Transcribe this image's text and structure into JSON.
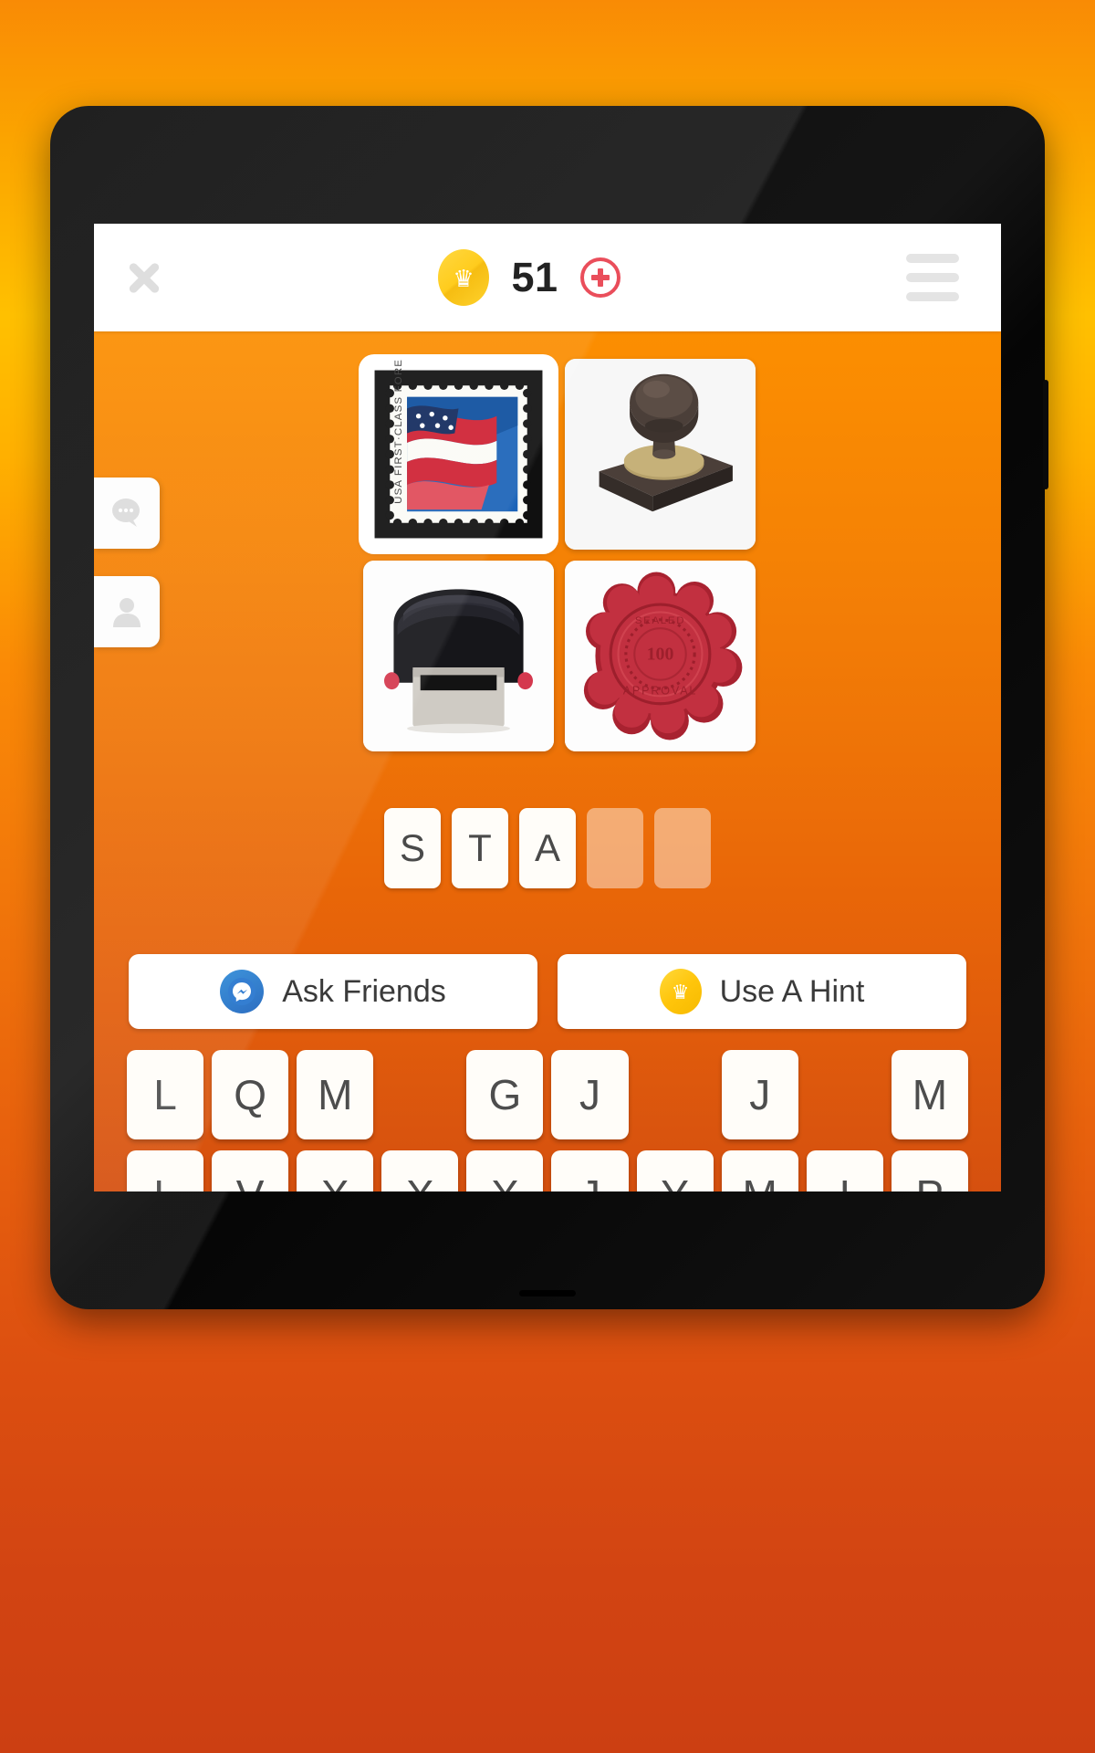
{
  "header": {
    "close_icon": "close-x-icon",
    "crown_icon": "crown-coin-icon",
    "coin_count": "51",
    "add_icon": "plus-circle-icon",
    "menu_icon": "hamburger-menu-icon"
  },
  "side_tabs": [
    {
      "icon": "chat-bubble-icon",
      "name": "chat-tab"
    },
    {
      "icon": "person-icon",
      "name": "profile-tab"
    }
  ],
  "puzzle": {
    "images": [
      {
        "alt": "USA First Class Forever postage stamp with American flag",
        "caption": "USA FIRST-CLASS FOREVER",
        "selected": true
      },
      {
        "alt": "Wooden handle metal rubber stamp with round knob",
        "caption": "",
        "selected": false
      },
      {
        "alt": "Black self-inking rubber stamp",
        "caption": "",
        "selected": false
      },
      {
        "alt": "Red wax seal stamped APPROVAL 100",
        "caption": "APPROVAL",
        "selected": false
      }
    ],
    "answer_slots": [
      {
        "letter": "S",
        "filled": true
      },
      {
        "letter": "T",
        "filled": true
      },
      {
        "letter": "A",
        "filled": true
      },
      {
        "letter": "",
        "filled": false
      },
      {
        "letter": "",
        "filled": false
      }
    ]
  },
  "actions": {
    "ask_friends": {
      "label": "Ask Friends",
      "icon": "messenger-icon"
    },
    "use_hint": {
      "label": "Use A Hint",
      "icon": "crown-coin-icon"
    }
  },
  "keyboard": {
    "rows": [
      [
        {
          "letter": "L",
          "used": false
        },
        {
          "letter": "Q",
          "used": false
        },
        {
          "letter": "M",
          "used": false
        },
        {
          "letter": "",
          "used": true
        },
        {
          "letter": "G",
          "used": false
        },
        {
          "letter": "J",
          "used": false
        },
        {
          "letter": "",
          "used": true
        },
        {
          "letter": "J",
          "used": false
        },
        {
          "letter": "",
          "used": true
        },
        {
          "letter": "M",
          "used": false
        }
      ],
      [
        {
          "letter": "L",
          "used": false
        },
        {
          "letter": "V",
          "used": false
        },
        {
          "letter": "X",
          "used": false
        },
        {
          "letter": "X",
          "used": false
        },
        {
          "letter": "X",
          "used": false
        },
        {
          "letter": "J",
          "used": false
        },
        {
          "letter": "Y",
          "used": false
        },
        {
          "letter": "M",
          "used": false
        },
        {
          "letter": "I",
          "used": false
        },
        {
          "letter": "P",
          "used": false
        }
      ]
    ]
  },
  "colors": {
    "background_top": "#f98b05",
    "background_mid": "#ffc000",
    "background_bottom": "#cc3f12",
    "screen_orange": "#f58205",
    "coin_yellow": "#ffc80c",
    "accent_red": "#e8414f",
    "messenger_blue": "#1c63bd",
    "tile_white": "#fffdf9"
  }
}
